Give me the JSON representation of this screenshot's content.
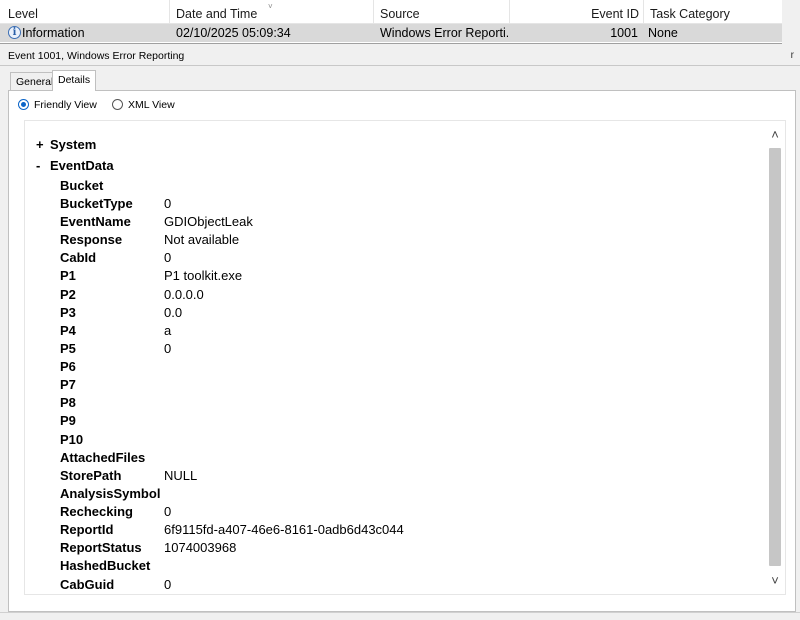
{
  "columns": {
    "level": "Level",
    "datetime": "Date and Time",
    "source": "Source",
    "event_id": "Event ID",
    "task_category": "Task Category"
  },
  "event_row": {
    "level": "Information",
    "datetime": "02/10/2025 05:09:34",
    "source": "Windows Error Reporti...",
    "event_id": "1001",
    "task_category": "None"
  },
  "pane": {
    "title": "Event 1001, Windows Error Reporting",
    "close_glyph": "r"
  },
  "tabs": [
    {
      "label": "General"
    },
    {
      "label": "Details"
    }
  ],
  "views": {
    "friendly": "Friendly View",
    "xml": "XML View"
  },
  "tree": {
    "system": {
      "sign": "+",
      "label": "System"
    },
    "eventdata": {
      "sign": "-",
      "label": "EventData"
    }
  },
  "fields": [
    {
      "key": "Bucket",
      "value": ""
    },
    {
      "key": "BucketType",
      "value": "0"
    },
    {
      "key": "EventName",
      "value": "GDIObjectLeak"
    },
    {
      "key": "Response",
      "value": "Not available"
    },
    {
      "key": "CabId",
      "value": "0"
    },
    {
      "key": "P1",
      "value": "P1 toolkit.exe"
    },
    {
      "key": "P2",
      "value": "0.0.0.0"
    },
    {
      "key": "P3",
      "value": "0.0"
    },
    {
      "key": "P4",
      "value": "a"
    },
    {
      "key": "P5",
      "value": "0"
    },
    {
      "key": "P6",
      "value": ""
    },
    {
      "key": "P7",
      "value": ""
    },
    {
      "key": "P8",
      "value": ""
    },
    {
      "key": "P9",
      "value": ""
    },
    {
      "key": "P10",
      "value": ""
    },
    {
      "key": "AttachedFiles",
      "value": ""
    },
    {
      "key": "StorePath",
      "value": "NULL"
    },
    {
      "key": "AnalysisSymbol",
      "value": ""
    },
    {
      "key": "Rechecking",
      "value": "0"
    },
    {
      "key": "ReportId",
      "value": "6f9115fd-a407-46e6-8161-0adb6d43c044"
    },
    {
      "key": "ReportStatus",
      "value": "1074003968"
    },
    {
      "key": "HashedBucket",
      "value": ""
    },
    {
      "key": "CabGuid",
      "value": "0"
    }
  ],
  "icons": {
    "info": "information-icon",
    "scroll_up": "chevron-up-icon",
    "scroll_down": "chevron-down-icon"
  },
  "colors": {
    "selected_row": "#d9d9d9",
    "radio_accent": "#0a64c8",
    "scroll_thumb": "#c6c6c6"
  }
}
